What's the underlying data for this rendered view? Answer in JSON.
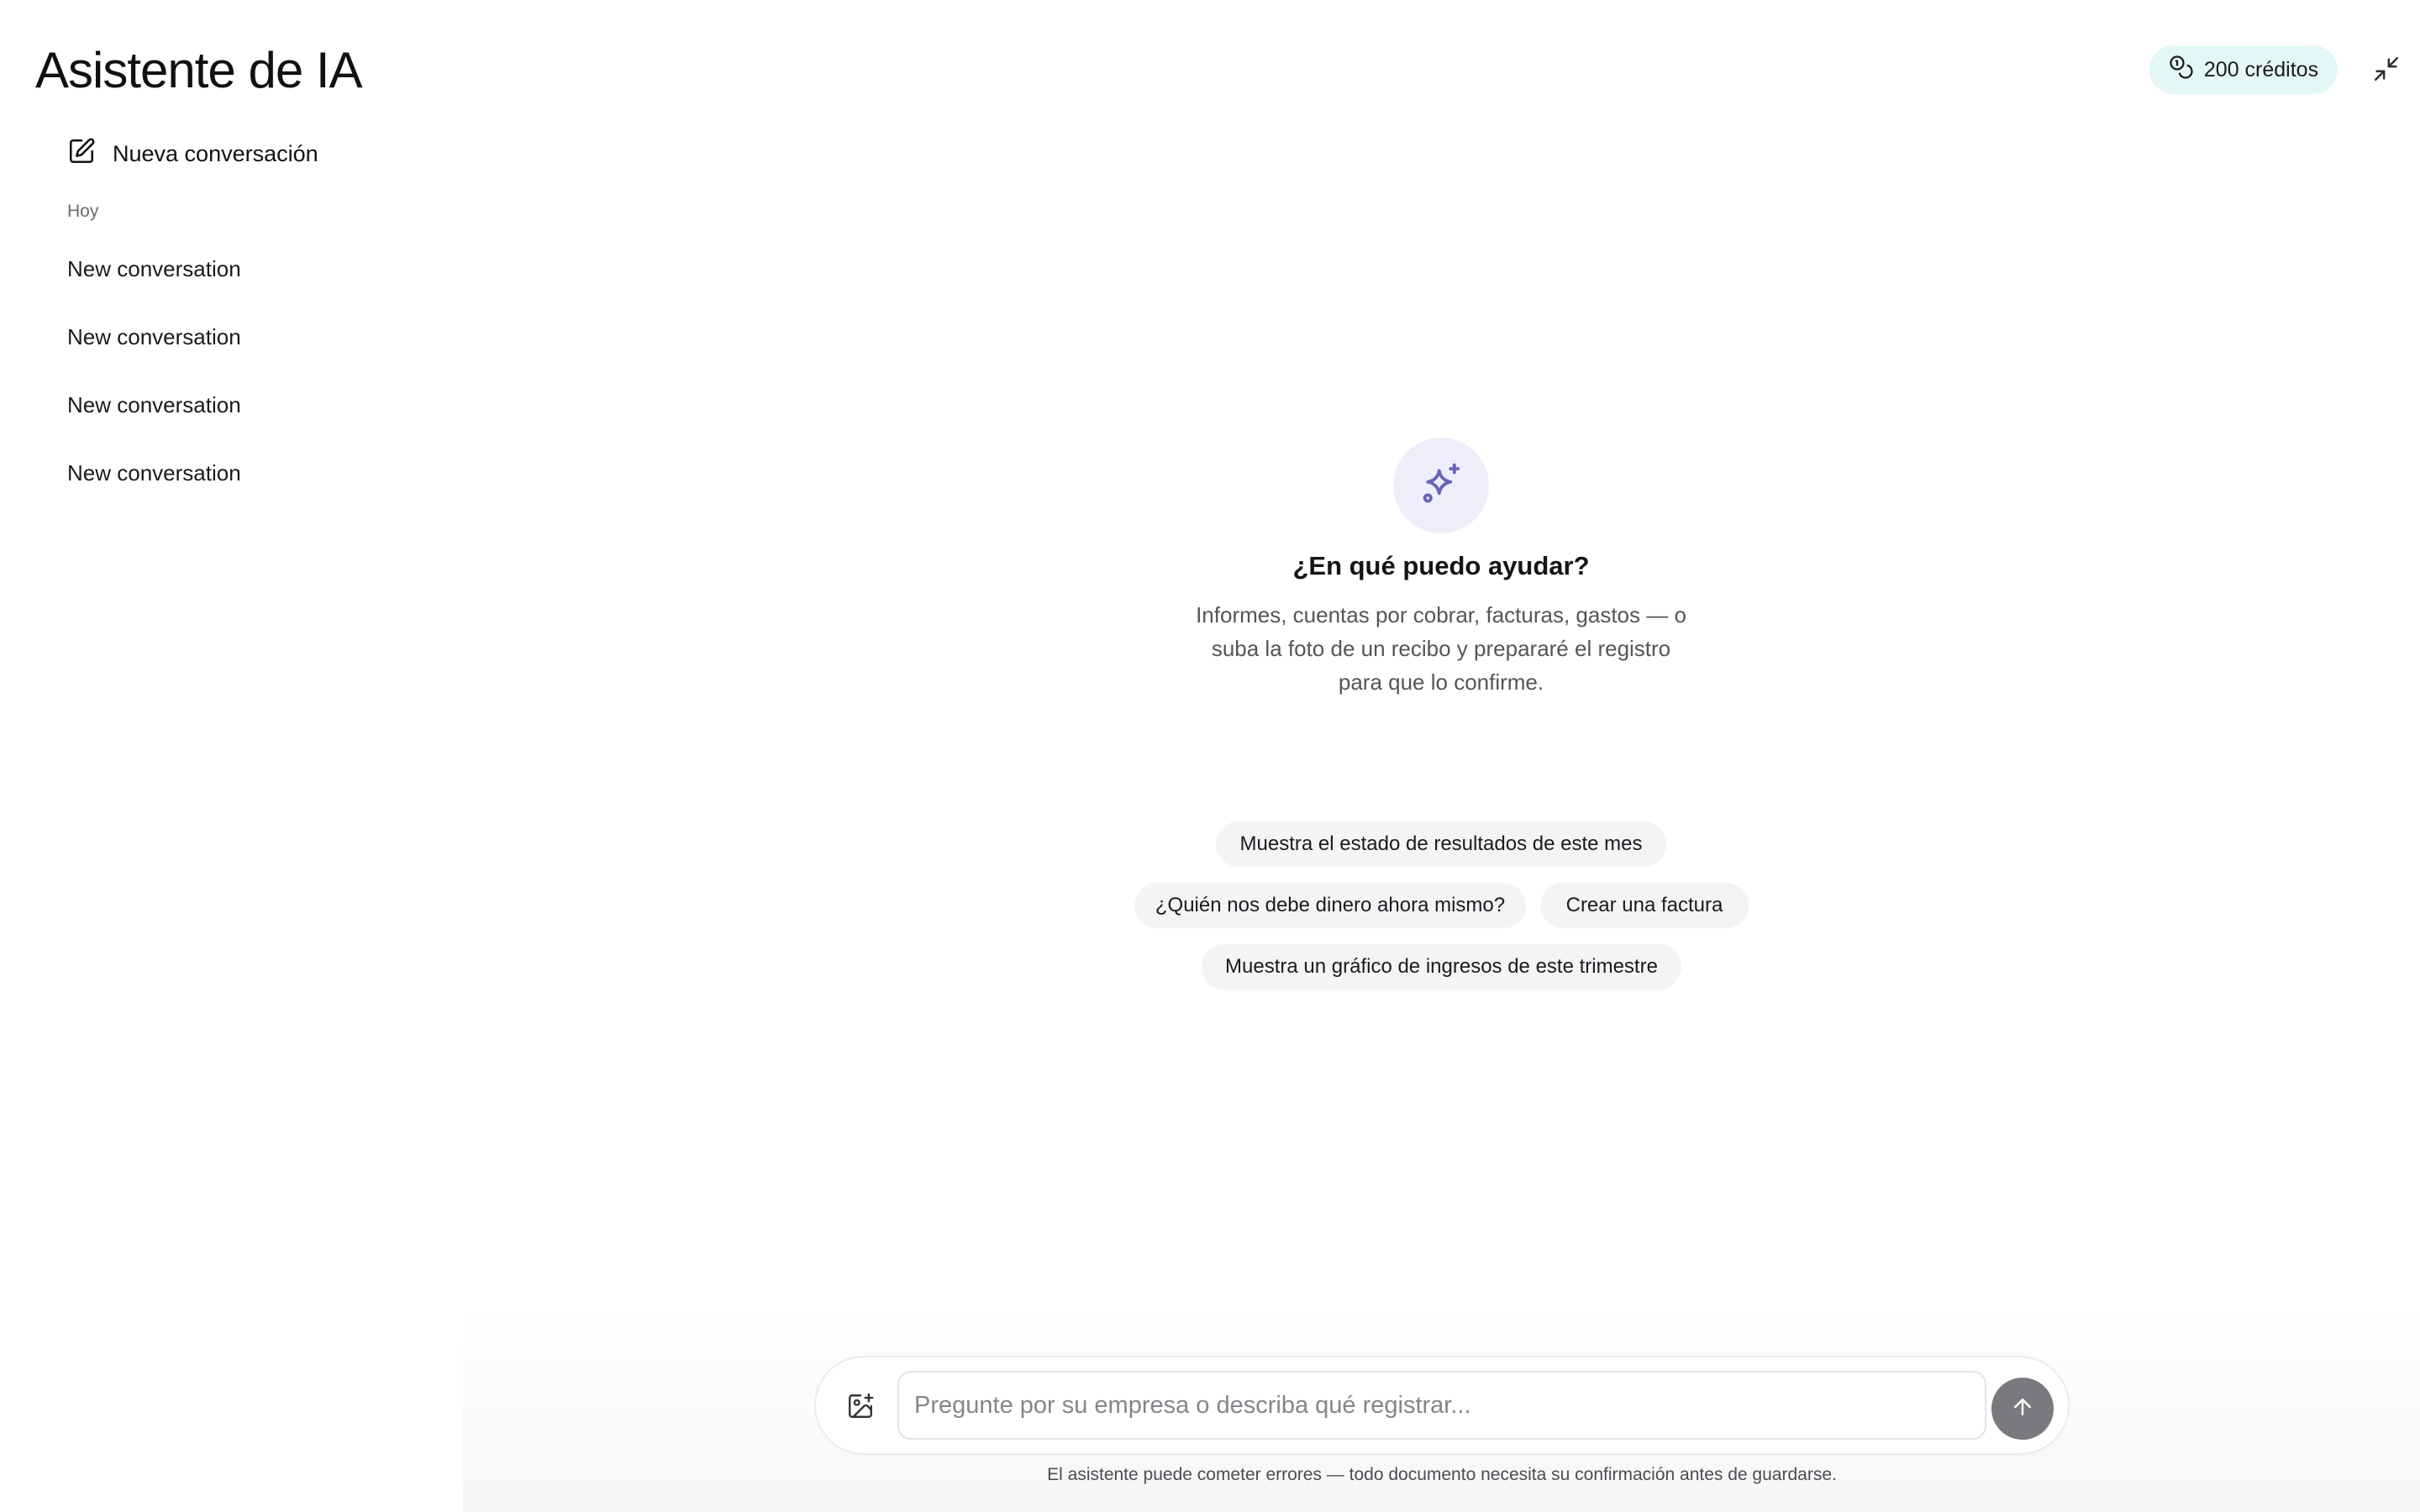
{
  "app": {
    "title": "Asistente de IA"
  },
  "header": {
    "credits_label": "200 créditos"
  },
  "sidebar": {
    "new_conversation_label": "Nueva conversación",
    "section_label": "Hoy",
    "conversations": [
      {
        "label": "New conversation"
      },
      {
        "label": "New conversation"
      },
      {
        "label": "New conversation"
      },
      {
        "label": "New conversation"
      }
    ]
  },
  "main": {
    "heading": "¿En qué puedo ayudar?",
    "subheading": "Informes, cuentas por cobrar, facturas, gastos — o suba la foto de un recibo y prepararé el registro para que lo confirme.",
    "suggestions": [
      "Muestra el estado de resultados de este mes",
      "¿Quién nos debe dinero ahora mismo?",
      "Crear una factura",
      "Muestra un gráfico de ingresos de este trimestre"
    ]
  },
  "composer": {
    "placeholder": "Pregunte por su empresa o describa qué registrar...",
    "value": "",
    "disclaimer": "El asistente puede cometer errores — todo documento necesita su confirmación antes de guardarse."
  },
  "icons": {
    "credits": "coins-icon",
    "collapse": "minimize-icon",
    "new_conversation": "edit-icon",
    "hero": "sparkles-icon",
    "attach": "image-plus-icon",
    "send": "arrow-up-icon"
  },
  "colors": {
    "credits_badge_bg": "#e3f8f6",
    "hero_icon_bg": "#eeeefb",
    "hero_icon_fg": "#6a63b5",
    "send_button_bg": "#7a7a7e",
    "chip_bg": "#f4f4f6"
  }
}
